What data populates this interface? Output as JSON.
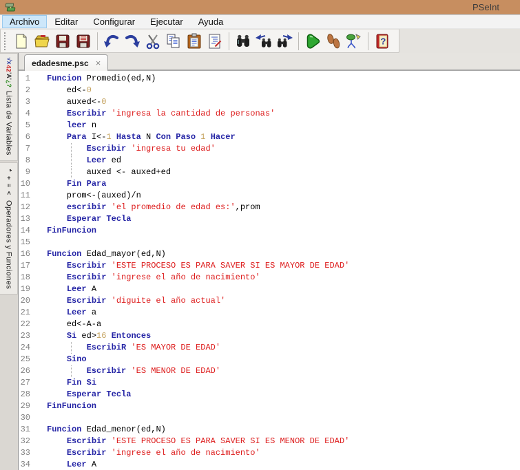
{
  "titlebar": {
    "app_title": "PSeInt",
    "accent_color": "#C78E60"
  },
  "menubar": {
    "items": [
      {
        "label": "Archivo",
        "active": true
      },
      {
        "label": "Editar",
        "active": false
      },
      {
        "label": "Configurar",
        "active": false
      },
      {
        "label": "Ejecutar",
        "active": false
      },
      {
        "label": "Ayuda",
        "active": false
      }
    ]
  },
  "toolbar": {
    "buttons": [
      "new-file",
      "open-file",
      "save-file",
      "save-all",
      "|",
      "undo",
      "redo",
      "cut",
      "copy",
      "paste",
      "fix-indent",
      "|",
      "find",
      "find-prev",
      "find-next",
      "|",
      "run",
      "step-run",
      "draw-flowchart",
      "|",
      "help"
    ]
  },
  "sidebar": {
    "tabs": [
      {
        "name": "lista-de-variables",
        "label": "Lista de Variables",
        "icon_glyphs": [
          {
            "t": "√x",
            "c": "#2B3E9E"
          },
          {
            "t": "42",
            "c": "#CC2222"
          },
          {
            "t": "'A'",
            "c": "#333333"
          },
          {
            "t": "¿?",
            "c": "#2E8B22"
          }
        ]
      },
      {
        "name": "operadores-y-funciones",
        "label": "Operadores y Funciones",
        "icon_glyphs": [
          {
            "t": "*",
            "c": "#222222"
          },
          {
            "t": "+",
            "c": "#222222"
          },
          {
            "t": "=",
            "c": "#222222"
          },
          {
            "t": "<",
            "c": "#222222"
          }
        ]
      }
    ]
  },
  "document_tab": {
    "filename": "edadesme.psc",
    "close_glyph": "×"
  },
  "editor": {
    "syntax_colors": {
      "keyword": "#2626A6",
      "string": "#DD1C1C",
      "number": "#C5A35F",
      "plain": "#000000",
      "line_number": "#808080"
    },
    "lines": [
      {
        "n": 1,
        "guide": false,
        "segs": [
          [
            "k",
            "Funcion"
          ],
          [
            "p",
            " Promedio(ed,N)"
          ]
        ]
      },
      {
        "n": 2,
        "guide": false,
        "segs": [
          [
            "p",
            "    ed<-"
          ],
          [
            "n",
            "0"
          ]
        ]
      },
      {
        "n": 3,
        "guide": false,
        "segs": [
          [
            "p",
            "    auxed<-"
          ],
          [
            "n",
            "0"
          ]
        ]
      },
      {
        "n": 4,
        "guide": false,
        "segs": [
          [
            "p",
            "    "
          ],
          [
            "k",
            "Escribir"
          ],
          [
            "p",
            " "
          ],
          [
            "s",
            "'ingresa la cantidad de personas'"
          ]
        ]
      },
      {
        "n": 5,
        "guide": false,
        "segs": [
          [
            "p",
            "    "
          ],
          [
            "k",
            "leer"
          ],
          [
            "p",
            " n"
          ]
        ]
      },
      {
        "n": 6,
        "guide": false,
        "segs": [
          [
            "p",
            "    "
          ],
          [
            "k",
            "Para"
          ],
          [
            "p",
            " I<-"
          ],
          [
            "n",
            "1"
          ],
          [
            "p",
            " "
          ],
          [
            "k",
            "Hasta"
          ],
          [
            "p",
            " N "
          ],
          [
            "k",
            "Con Paso"
          ],
          [
            "p",
            " "
          ],
          [
            "n",
            "1"
          ],
          [
            "p",
            " "
          ],
          [
            "k",
            "Hacer"
          ]
        ]
      },
      {
        "n": 7,
        "guide": true,
        "segs": [
          [
            "p",
            "        "
          ],
          [
            "k",
            "Escribir"
          ],
          [
            "p",
            " "
          ],
          [
            "s",
            "'ingresa tu edad'"
          ]
        ]
      },
      {
        "n": 8,
        "guide": true,
        "segs": [
          [
            "p",
            "        "
          ],
          [
            "k",
            "Leer"
          ],
          [
            "p",
            " ed"
          ]
        ]
      },
      {
        "n": 9,
        "guide": true,
        "segs": [
          [
            "p",
            "        auxed <- auxed+ed"
          ]
        ]
      },
      {
        "n": 10,
        "guide": false,
        "segs": [
          [
            "p",
            "    "
          ],
          [
            "k",
            "Fin Para"
          ]
        ]
      },
      {
        "n": 11,
        "guide": false,
        "segs": [
          [
            "p",
            "    prom<-(auxed)/n"
          ]
        ]
      },
      {
        "n": 12,
        "guide": false,
        "segs": [
          [
            "p",
            "    "
          ],
          [
            "k",
            "escribir"
          ],
          [
            "p",
            " "
          ],
          [
            "s",
            "'el promedio de edad es:'"
          ],
          [
            "p",
            ",prom"
          ]
        ]
      },
      {
        "n": 13,
        "guide": false,
        "segs": [
          [
            "p",
            "    "
          ],
          [
            "k",
            "Esperar Tecla"
          ]
        ]
      },
      {
        "n": 14,
        "guide": false,
        "segs": [
          [
            "k",
            "FinFuncion"
          ]
        ]
      },
      {
        "n": 15,
        "guide": false,
        "segs": []
      },
      {
        "n": 16,
        "guide": false,
        "segs": [
          [
            "k",
            "Funcion"
          ],
          [
            "p",
            " Edad_mayor(ed,N)"
          ]
        ]
      },
      {
        "n": 17,
        "guide": false,
        "segs": [
          [
            "p",
            "    "
          ],
          [
            "k",
            "Escribir"
          ],
          [
            "p",
            " "
          ],
          [
            "s",
            "'ESTE PROCESO ES PARA SAVER SI ES MAYOR DE EDAD'"
          ]
        ]
      },
      {
        "n": 18,
        "guide": false,
        "segs": [
          [
            "p",
            "    "
          ],
          [
            "k",
            "Escribir"
          ],
          [
            "p",
            " "
          ],
          [
            "s",
            "'ingrese el año de nacimiento'"
          ]
        ]
      },
      {
        "n": 19,
        "guide": false,
        "segs": [
          [
            "p",
            "    "
          ],
          [
            "k",
            "Leer"
          ],
          [
            "p",
            " A"
          ]
        ]
      },
      {
        "n": 20,
        "guide": false,
        "segs": [
          [
            "p",
            "    "
          ],
          [
            "k",
            "Escribir"
          ],
          [
            "p",
            " "
          ],
          [
            "s",
            "'diguite el año actual'"
          ]
        ]
      },
      {
        "n": 21,
        "guide": false,
        "segs": [
          [
            "p",
            "    "
          ],
          [
            "k",
            "Leer"
          ],
          [
            "p",
            " a"
          ]
        ]
      },
      {
        "n": 22,
        "guide": false,
        "segs": [
          [
            "p",
            "    ed<-A-a"
          ]
        ]
      },
      {
        "n": 23,
        "guide": false,
        "segs": [
          [
            "p",
            "    "
          ],
          [
            "k",
            "Si"
          ],
          [
            "p",
            " ed>"
          ],
          [
            "n",
            "16"
          ],
          [
            "p",
            " "
          ],
          [
            "k",
            "Entonces"
          ]
        ]
      },
      {
        "n": 24,
        "guide": true,
        "segs": [
          [
            "p",
            "        "
          ],
          [
            "k",
            "EscribiR"
          ],
          [
            "p",
            " "
          ],
          [
            "s",
            "'ES MAYOR DE EDAD'"
          ]
        ]
      },
      {
        "n": 25,
        "guide": false,
        "segs": [
          [
            "p",
            "    "
          ],
          [
            "k",
            "Sino"
          ]
        ]
      },
      {
        "n": 26,
        "guide": true,
        "segs": [
          [
            "p",
            "        "
          ],
          [
            "k",
            "Escribir"
          ],
          [
            "p",
            " "
          ],
          [
            "s",
            "'ES MENOR DE EDAD'"
          ]
        ]
      },
      {
        "n": 27,
        "guide": false,
        "segs": [
          [
            "p",
            "    "
          ],
          [
            "k",
            "Fin Si"
          ]
        ]
      },
      {
        "n": 28,
        "guide": false,
        "segs": [
          [
            "p",
            "    "
          ],
          [
            "k",
            "Esperar Tecla"
          ]
        ]
      },
      {
        "n": 29,
        "guide": false,
        "segs": [
          [
            "k",
            "FinFuncion"
          ]
        ]
      },
      {
        "n": 30,
        "guide": false,
        "segs": []
      },
      {
        "n": 31,
        "guide": false,
        "segs": [
          [
            "k",
            "Funcion"
          ],
          [
            "p",
            " Edad_menor(ed,N)"
          ]
        ]
      },
      {
        "n": 32,
        "guide": false,
        "segs": [
          [
            "p",
            "    "
          ],
          [
            "k",
            "Escribir"
          ],
          [
            "p",
            " "
          ],
          [
            "s",
            "'ESTE PROCESO ES PARA SAVER SI ES MENOR DE EDAD'"
          ]
        ]
      },
      {
        "n": 33,
        "guide": false,
        "segs": [
          [
            "p",
            "    "
          ],
          [
            "k",
            "Escribir"
          ],
          [
            "p",
            " "
          ],
          [
            "s",
            "'ingrese el año de nacimiento'"
          ]
        ]
      },
      {
        "n": 34,
        "guide": false,
        "segs": [
          [
            "p",
            "    "
          ],
          [
            "k",
            "Leer"
          ],
          [
            "p",
            " A"
          ]
        ]
      }
    ]
  }
}
